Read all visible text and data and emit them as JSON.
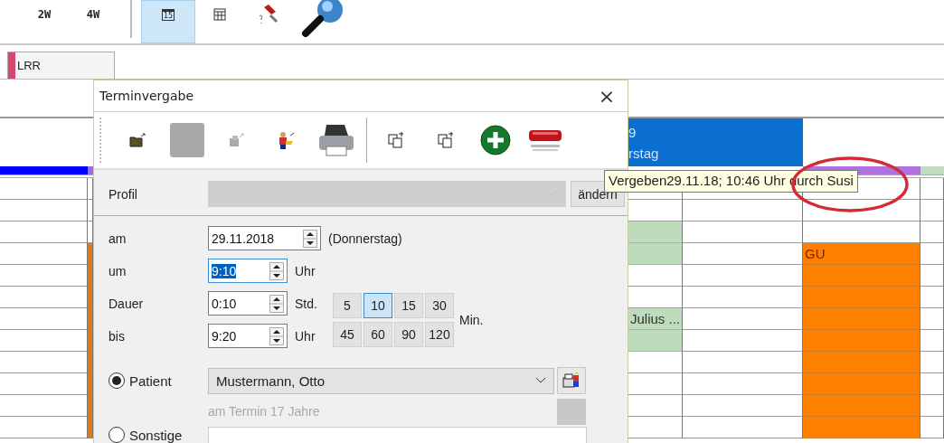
{
  "toolbar": {
    "buttons": [
      {
        "kind": "text",
        "label": "2W",
        "selected": false
      },
      {
        "kind": "text",
        "label": "4W",
        "selected": false
      },
      {
        "kind": "separator"
      },
      {
        "kind": "calendar",
        "label": "15",
        "selected": true
      },
      {
        "kind": "table",
        "selected": false
      },
      {
        "kind": "flashlight",
        "selected": false
      },
      {
        "kind": "magnifier",
        "selected": false
      }
    ]
  },
  "resource_tabs": [
    {
      "label": "LRR",
      "color": "#d6476e"
    }
  ],
  "calendar": {
    "day_header": {
      "lines": [
        "9",
        "rstag"
      ]
    },
    "columns": [
      {
        "bar": {
          "color": "#0000ff"
        },
        "slots": [
          {
            "booked": false
          },
          {
            "booked": false
          },
          {
            "booked": false
          },
          {
            "booked": false
          },
          {
            "booked": false
          },
          {
            "booked": false
          },
          {
            "booked": false
          },
          {
            "booked": false
          },
          {
            "booked": false
          },
          {
            "booked": false
          },
          {
            "booked": false
          },
          {
            "booked": false
          }
        ]
      },
      {
        "bar": {
          "color": "#9b6fcf"
        },
        "slots": [
          {
            "booked": false
          },
          {
            "booked": false
          },
          {
            "booked": false
          },
          {
            "booked": true,
            "color": "#e07c10"
          },
          {
            "booked": true,
            "color": "#e07c10"
          },
          {
            "booked": true,
            "color": "#e07c10"
          },
          {
            "booked": true,
            "color": "#e07c10"
          },
          {
            "booked": true,
            "color": "#e07c10"
          },
          {
            "booked": true,
            "color": "#e07c10"
          },
          {
            "booked": true,
            "color": "#e07c10"
          },
          {
            "booked": true,
            "color": "#e07c10"
          },
          {
            "booked": true,
            "color": "#e07c10"
          }
        ]
      },
      {
        "slots": [
          {
            "booked": false
          },
          {
            "booked": false
          },
          {
            "booked": true,
            "color": "#bcdcbc"
          },
          {
            "booked": true,
            "color": "#bcdcbc"
          },
          {
            "booked": false
          },
          {
            "booked": false
          },
          {
            "booked": true,
            "color": "#bcdcbc",
            "text": "Julius ..."
          },
          {
            "booked": true,
            "color": "#bcdcbc"
          },
          {
            "booked": false
          },
          {
            "booked": false
          },
          {
            "booked": false
          },
          {
            "booked": false
          }
        ]
      },
      {
        "slots": [
          {
            "booked": false
          },
          {
            "booked": false
          },
          {
            "booked": false
          },
          {
            "booked": false
          },
          {
            "booked": false
          },
          {
            "booked": false
          },
          {
            "booked": false
          },
          {
            "booked": false
          },
          {
            "booked": false
          },
          {
            "booked": false
          },
          {
            "booked": false
          },
          {
            "booked": false
          }
        ]
      },
      {
        "bar": {
          "color": "#b070e0"
        },
        "slots": [
          {
            "booked": false
          },
          {
            "booked": false
          },
          {
            "booked": false
          },
          {
            "booked": true,
            "color": "#ff8000",
            "text": "GU"
          },
          {
            "booked": true,
            "color": "#ff8000"
          },
          {
            "booked": true,
            "color": "#ff8000"
          },
          {
            "booked": true,
            "color": "#ff8000"
          },
          {
            "booked": true,
            "color": "#ff8000"
          },
          {
            "booked": true,
            "color": "#ff8000"
          },
          {
            "booked": true,
            "color": "#ff8000"
          },
          {
            "booked": true,
            "color": "#ff8000"
          },
          {
            "booked": true,
            "color": "#ff8000"
          }
        ]
      },
      {
        "bar": {
          "color": "#c0dcc0"
        },
        "slots": [
          {
            "booked": false
          },
          {
            "booked": false
          },
          {
            "booked": false
          },
          {
            "booked": false
          },
          {
            "booked": false
          },
          {
            "booked": false
          },
          {
            "booked": false
          },
          {
            "booked": false
          },
          {
            "booked": false
          },
          {
            "booked": false
          },
          {
            "booked": false
          },
          {
            "booked": false
          }
        ]
      }
    ]
  },
  "dialog": {
    "title": "Terminvergabe",
    "close": "×",
    "tools": [
      {
        "kind": "folder"
      },
      {
        "kind": "blank"
      },
      {
        "kind": "stamp"
      },
      {
        "kind": "person"
      },
      {
        "kind": "printer"
      },
      {
        "kind": "separator"
      },
      {
        "kind": "copy"
      },
      {
        "kind": "copy"
      },
      {
        "kind": "add"
      },
      {
        "kind": "remove"
      }
    ],
    "profile": {
      "label": "Profil",
      "disabled": true,
      "button": "ändern"
    },
    "date": {
      "label": "am",
      "value": "29.11.2018",
      "weekday": "(Donnerstag)"
    },
    "times": [
      {
        "label": "um",
        "value": "9:10",
        "text_selected": true,
        "unit": "Uhr"
      },
      {
        "label": "Dauer",
        "value": "0:10",
        "text_selected": false,
        "unit": "Std."
      },
      {
        "label": "bis",
        "value": "9:20",
        "text_selected": false,
        "unit": "Uhr"
      }
    ],
    "minutes": {
      "buttons": [
        {
          "label": "5",
          "selected": false
        },
        {
          "label": "10",
          "selected": true
        },
        {
          "label": "15",
          "selected": false
        },
        {
          "label": "30",
          "selected": false
        },
        {
          "label": "45",
          "selected": false
        },
        {
          "label": "60",
          "selected": false
        },
        {
          "label": "90",
          "selected": false
        },
        {
          "label": "120",
          "selected": false
        }
      ],
      "unit": "Min."
    },
    "recipients": [
      {
        "kind": "patient",
        "label": "Patient",
        "selected": true,
        "value": "Mustermann, Otto",
        "note": "am Termin 17 Jahre"
      },
      {
        "kind": "other",
        "label": "Sonstige",
        "selected": false
      }
    ]
  },
  "tooltip": {
    "text": "Vergeben29.11.18; 10:46 Uhr durch Susi"
  },
  "annotation": {
    "kind": "ellipse",
    "color": "#d42a35"
  }
}
